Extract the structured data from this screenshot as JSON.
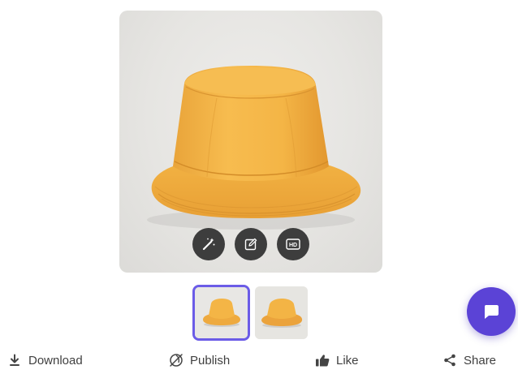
{
  "preview": {
    "image": "yellow-bucket-hat",
    "tools": [
      {
        "icon": "magic-wand-icon",
        "name": "magic-edit-button"
      },
      {
        "icon": "edit-icon",
        "name": "edit-button"
      },
      {
        "icon": "hd-icon",
        "name": "hd-upscale-button"
      }
    ],
    "hd_label": "HD"
  },
  "thumbnails": [
    {
      "image": "yellow-bucket-hat-front",
      "selected": true
    },
    {
      "image": "yellow-bucket-hat-side",
      "selected": false
    }
  ],
  "actions": {
    "download_label": "Download",
    "publish_label": "Publish",
    "like_label": "Like",
    "share_label": "Share"
  },
  "chat": {
    "icon": "chat-bubble-icon"
  },
  "colors": {
    "accent": "#5b43d6",
    "selected_border": "#6b5ce7",
    "hat": "#f5b84a",
    "tool_button": "#3d3d3d",
    "background": "#ffffff"
  }
}
